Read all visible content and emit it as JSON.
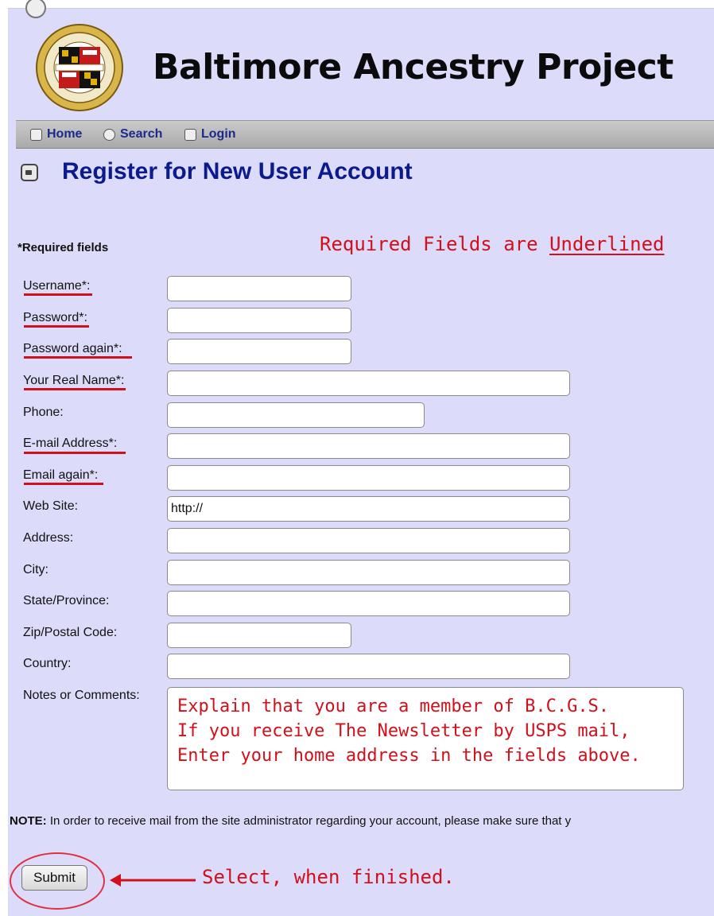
{
  "site": {
    "title": "Baltimore Ancestry Project",
    "logo_label": "Baltimore County Maryland Genealogical Society logo"
  },
  "nav": {
    "items": [
      {
        "label": "Home",
        "icon": "home-icon"
      },
      {
        "label": "Search",
        "icon": "search-icon"
      },
      {
        "label": "Login",
        "icon": "lock-icon"
      }
    ]
  },
  "page": {
    "heading": "Register for New User Account",
    "required_note": "*Required fields"
  },
  "annotation": {
    "required_prefix": "Required Fields are ",
    "required_underlined": "Underlined",
    "submit_hint": "Select, when finished."
  },
  "form": {
    "fields": [
      {
        "label": "Username*:",
        "value": ""
      },
      {
        "label": "Password*:",
        "value": ""
      },
      {
        "label": "Password again*:",
        "value": ""
      },
      {
        "label": "Your Real Name*:",
        "value": ""
      },
      {
        "label": "Phone:",
        "value": ""
      },
      {
        "label": "E-mail Address*:",
        "value": ""
      },
      {
        "label": "Email again*:",
        "value": ""
      },
      {
        "label": "Web Site:",
        "value": "http://"
      },
      {
        "label": "Address:",
        "value": ""
      },
      {
        "label": "City:",
        "value": ""
      },
      {
        "label": "State/Province:",
        "value": ""
      },
      {
        "label": "Zip/Postal Code:",
        "value": ""
      },
      {
        "label": "Country:",
        "value": ""
      }
    ],
    "comments": {
      "label": "Notes or Comments:",
      "value": "Explain that you are a member of B.C.G.S.\nIf you receive The Newsletter by USPS mail,\nEnter your home address in the fields above."
    },
    "note_bold": "NOTE:",
    "note_text": " In order to receive mail from the site administrator regarding your account, please make sure that y",
    "submit_label": "Submit"
  },
  "colors": {
    "page_background": "#dcdcfa",
    "heading": "#0b1a8c",
    "annotation_red": "#d0101a"
  }
}
